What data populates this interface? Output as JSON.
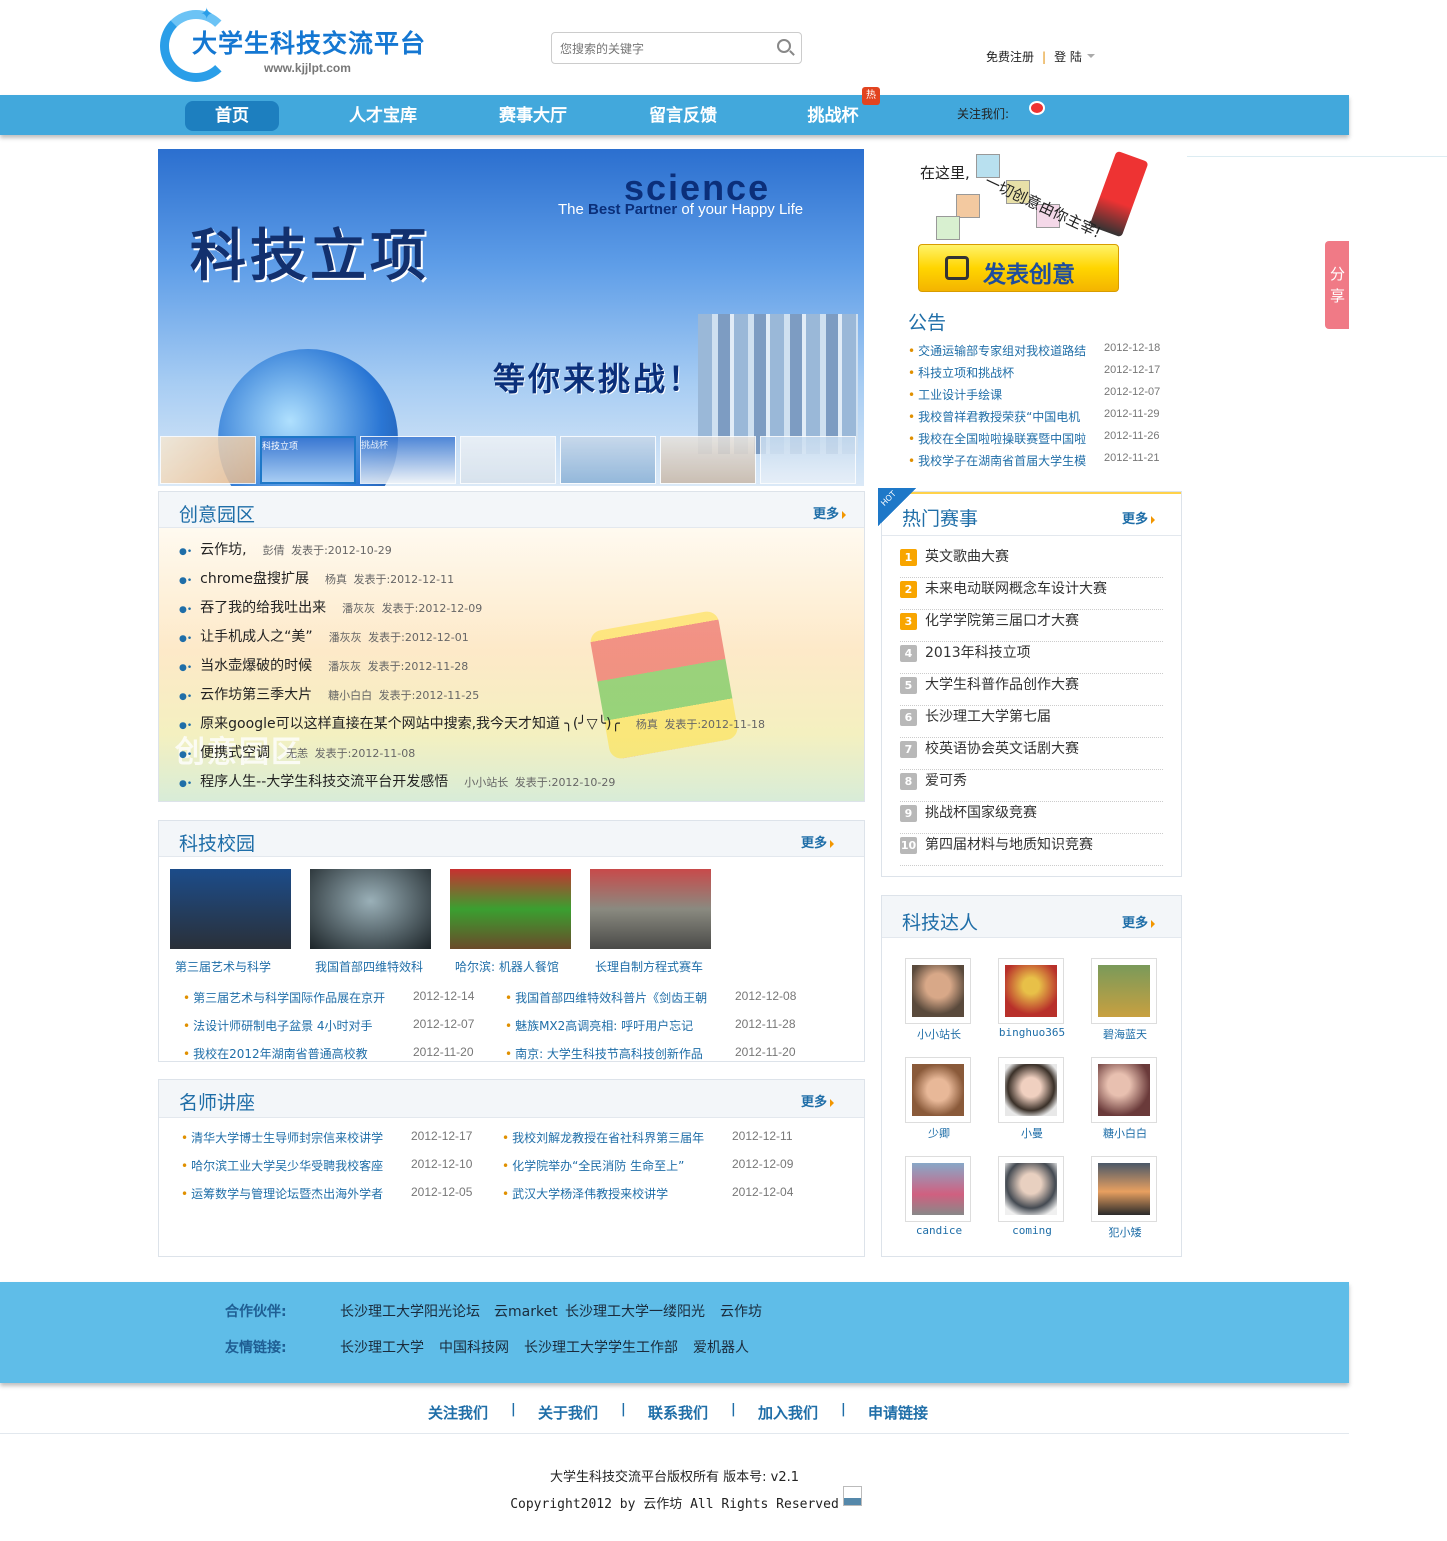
{
  "site": {
    "name": "大学生科技交流平台",
    "url": "www.kjjlpt.com"
  },
  "search": {
    "placeholder": "您搜索的关键字"
  },
  "user": {
    "register": "免费注册",
    "sep": "|",
    "login": "登 陆"
  },
  "nav": {
    "items": [
      {
        "label": "首页"
      },
      {
        "label": "人才宝库"
      },
      {
        "label": "赛事大厅"
      },
      {
        "label": "留言反馈"
      },
      {
        "label": "挑战杯"
      }
    ],
    "hot_badge": "热",
    "follow": "关注我们:"
  },
  "banner": {
    "big": "科技立项",
    "science": "science",
    "subtitle_pre": "The",
    "subtitle_best": "Best Partner",
    "subtitle_of": "of your",
    "subtitle_life": "Happy Life",
    "challenge": "等你来挑战！",
    "thumb_labels": [
      "",
      "科技立项",
      "挑战杯",
      "",
      "",
      "",
      "",
      ""
    ]
  },
  "idea": {
    "line1": "在这里,",
    "line2": "一切创意由你主宰!",
    "post_button": "发表创意"
  },
  "notice": {
    "title": "公告",
    "items": [
      {
        "t": "交通运输部专家组对我校道路结",
        "d": "2012-12-18"
      },
      {
        "t": "科技立项和挑战杯",
        "d": "2012-12-17"
      },
      {
        "t": "工业设计手绘课",
        "d": "2012-12-07"
      },
      {
        "t": "我校曾祥君教授荣获“中国电机",
        "d": "2012-11-29"
      },
      {
        "t": "我校在全国啦啦操联赛暨中国啦",
        "d": "2012-11-26"
      },
      {
        "t": "我校学子在湖南省首届大学生模",
        "d": "2012-11-21"
      }
    ]
  },
  "share": {
    "label": "分享"
  },
  "more_label": "更多",
  "creative": {
    "title": "创意园区",
    "bg_text": "创意园区",
    "items": [
      {
        "t": "云作坊,",
        "a": "彭倩",
        "d": "发表于:2012-10-29"
      },
      {
        "t": "chrome盘搜扩展",
        "a": "杨真",
        "d": "发表于:2012-12-11"
      },
      {
        "t": "吞了我的给我吐出来",
        "a": "潘灰灰",
        "d": "发表于:2012-12-09"
      },
      {
        "t": "让手机成人之“美”",
        "a": "潘灰灰",
        "d": "发表于:2012-12-01"
      },
      {
        "t": "当水壶爆破的时候",
        "a": "潘灰灰",
        "d": "发表于:2012-11-28"
      },
      {
        "t": "云作坊第三季大片",
        "a": "糖小白白",
        "d": "发表于:2012-11-25"
      },
      {
        "t": "原来google可以这样直接在某个网站中搜索,我今天才知道 ╮(╯▽╰)╭",
        "a": "杨真",
        "d": "发表于:2012-11-18"
      },
      {
        "t": "便携式空调",
        "a": "无恙",
        "d": "发表于:2012-11-08"
      },
      {
        "t": "程序人生--大学生科技交流平台开发感悟",
        "a": "小小站长",
        "d": "发表于:2012-10-29"
      }
    ]
  },
  "campus": {
    "title": "科技校园",
    "photos": [
      {
        "cap": "第三届艺术与科学",
        "color": "#2a4f7a"
      },
      {
        "cap": "我国首部四维特效科",
        "color": "#2f3d44"
      },
      {
        "cap": "哈尔滨: 机器人餐馆",
        "color": "#8a4a2a"
      },
      {
        "cap": "长理自制方程式赛车",
        "color": "#6a6a62"
      }
    ],
    "news": [
      {
        "t": "第三届艺术与科学国际作品展在京开",
        "d": "2012-12-14"
      },
      {
        "t": "我国首部四维特效科普片《剑齿王朝",
        "d": "2012-12-08"
      },
      {
        "t": "法设计师研制电子盆景 4小时对手",
        "d": "2012-12-07"
      },
      {
        "t": "魅族MX2高调亮相: 呼吁用户忘记",
        "d": "2012-11-28"
      },
      {
        "t": "我校在2012年湖南省普通高校教",
        "d": "2012-11-20"
      },
      {
        "t": "南京: 大学生科技节高科技创新作品",
        "d": "2012-11-20"
      }
    ]
  },
  "lecture": {
    "title": "名师讲座",
    "news": [
      {
        "t": "清华大学博士生导师封宗信来校讲学",
        "d": "2012-12-17"
      },
      {
        "t": "我校刘解龙教授在省社科界第三届年",
        "d": "2012-12-11"
      },
      {
        "t": "哈尔滨工业大学吴少华受聘我校客座",
        "d": "2012-12-10"
      },
      {
        "t": "化学院举办“全民消防 生命至上”",
        "d": "2012-12-09"
      },
      {
        "t": "运筹数学与管理论坛暨杰出海外学者",
        "d": "2012-12-05"
      },
      {
        "t": "武汉大学杨泽伟教授来校讲学",
        "d": "2012-12-04"
      }
    ]
  },
  "hot": {
    "ribbon": "HOT",
    "title": "热门赛事",
    "items": [
      {
        "n": "1",
        "t": "英文歌曲大赛"
      },
      {
        "n": "2",
        "t": "未来电动联网概念车设计大赛"
      },
      {
        "n": "3",
        "t": "化学学院第三届口才大赛"
      },
      {
        "n": "4",
        "t": "2013年科技立项"
      },
      {
        "n": "5",
        "t": "大学生科普作品创作大赛"
      },
      {
        "n": "6",
        "t": "长沙理工大学第七届"
      },
      {
        "n": "7",
        "t": "校英语协会英文话剧大赛"
      },
      {
        "n": "8",
        "t": "爱可秀"
      },
      {
        "n": "9",
        "t": "挑战杯国家级竞赛"
      },
      {
        "n": "10",
        "t": "第四届材料与地质知识竞赛"
      }
    ]
  },
  "experts": {
    "title": "科技达人",
    "people": [
      {
        "name": "小小站长",
        "color": "#5a4a3c"
      },
      {
        "name": "binghuo365",
        "color": "#b8302a"
      },
      {
        "name": "碧海蓝天",
        "color": "#c8a040"
      },
      {
        "name": "少卿",
        "color": "#8a5a3a"
      },
      {
        "name": "小曼",
        "color": "#3a3028"
      },
      {
        "name": "糖小白白",
        "color": "#6a3a3a"
      },
      {
        "name": "candice",
        "color": "#d06080"
      },
      {
        "name": "coming",
        "color": "#444a52"
      },
      {
        "name": "犯小矮",
        "color": "#8a6a4a"
      }
    ]
  },
  "footer": {
    "partners_label": "合作伙伴:",
    "partners": [
      "长沙理工大学阳光论坛",
      "云market",
      "长沙理工大学一缕阳光",
      "云作坊"
    ],
    "friends_label": "友情链接:",
    "friends": [
      "长沙理工大学",
      "中国科技网",
      "长沙理工大学学生工作部",
      "爱机器人"
    ],
    "links": [
      "关注我们",
      "关于我们",
      "联系我们",
      "加入我们",
      "申请链接"
    ],
    "copyright": "大学生科技交流平台版权所有   版本号: v2.1",
    "copyright2": "Copyright2012 by 云作坊 All Rights Reserved"
  }
}
